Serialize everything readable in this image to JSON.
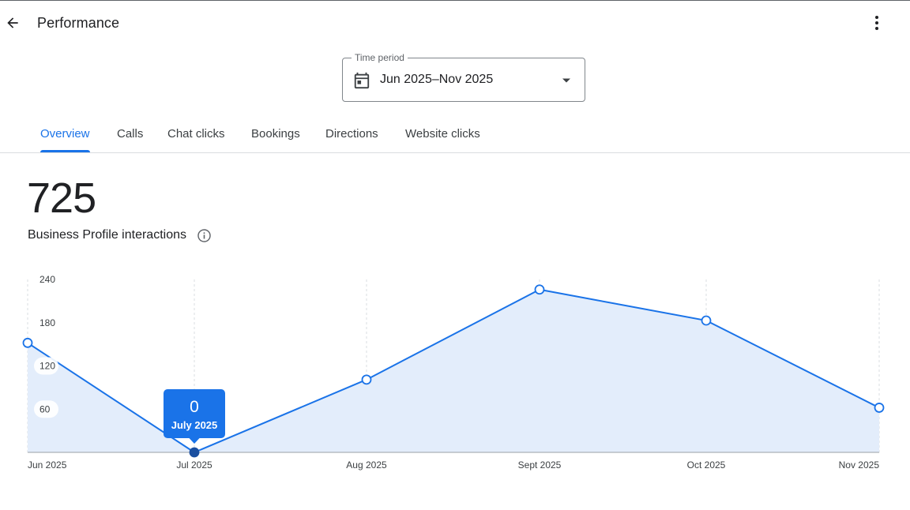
{
  "header": {
    "title": "Performance",
    "back_icon": "arrow-back-icon",
    "more_icon": "more-vert-icon"
  },
  "time_period": {
    "label": "Time period",
    "value": "Jun 2025–Nov 2025",
    "icon": "calendar-icon"
  },
  "tabs": [
    {
      "label": "Overview",
      "active": true
    },
    {
      "label": "Calls",
      "active": false
    },
    {
      "label": "Chat clicks",
      "active": false
    },
    {
      "label": "Bookings",
      "active": false
    },
    {
      "label": "Directions",
      "active": false
    },
    {
      "label": "Website clicks",
      "active": false
    }
  ],
  "metric": {
    "total": "725",
    "label": "Business Profile interactions"
  },
  "tooltip": {
    "value": "0",
    "label": "July 2025"
  },
  "colors": {
    "accent": "#1a73e8",
    "line": "#1a73e8",
    "area_fill": "#e3edfb",
    "selected_point": "#1a4fa0"
  },
  "chart_data": {
    "type": "area",
    "categories": [
      "Jun 2025",
      "Jul 2025",
      "Aug 2025",
      "Sept 2025",
      "Oct 2025",
      "Nov 2025"
    ],
    "values": [
      152,
      0,
      101,
      226,
      183,
      62
    ],
    "yticks": [
      60,
      120,
      180,
      240
    ],
    "ylim": [
      0,
      240
    ],
    "selected_index": 1,
    "grid": "vertical-dashed"
  }
}
